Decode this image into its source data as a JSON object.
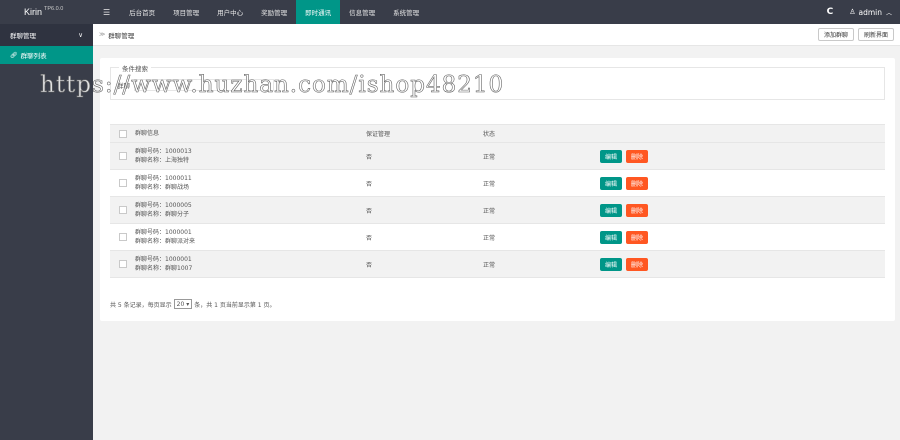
{
  "app": {
    "logo": "Kirin",
    "logo_sup": "TP6.0.0"
  },
  "nav": {
    "menu_icon": "☰",
    "items": [
      {
        "label": "后台首页"
      },
      {
        "label": "项目管理"
      },
      {
        "label": "用户中心"
      },
      {
        "label": "奖励管理"
      },
      {
        "label": "即时通讯"
      },
      {
        "label": "信息管理"
      },
      {
        "label": "系统管理"
      }
    ],
    "active_index": 4,
    "refresh_icon": "refresh-icon",
    "user": "admin"
  },
  "sidebar": {
    "group": "群聊管理",
    "item": "群聊列表"
  },
  "breadcrumb": {
    "text": "群聊管理",
    "btn_add": "添加群聊",
    "btn_refresh": "刷新界面"
  },
  "search": {
    "legend": "条件搜索",
    "label": "群聊",
    "placeholder": ""
  },
  "table": {
    "headers": {
      "info": "群聊信息",
      "owner": "保证管理",
      "status": "状态"
    },
    "rows": [
      {
        "line1": "群聊号码：1000013",
        "line2": "群聊名称：上海独特",
        "owner": "否",
        "status": "正常"
      },
      {
        "line1": "群聊号码：1000011",
        "line2": "群聊名称：群聊战场",
        "owner": "否",
        "status": "正常"
      },
      {
        "line1": "群聊号码：1000005",
        "line2": "群聊名称：群聊分子",
        "owner": "否",
        "status": "正常"
      },
      {
        "line1": "群聊号码：1000001",
        "line2": "群聊名称：群聊派对来",
        "owner": "否",
        "status": "正常"
      },
      {
        "line1": "群聊号码：1000001",
        "line2": "群聊名称：群聊1007",
        "owner": "否",
        "status": "正常"
      }
    ],
    "edit_label": "编辑",
    "delete_label": "删除"
  },
  "pager": {
    "prefix": "共 5 条记录，每页显示",
    "page_size": "20",
    "suffix": "条，共 1 页当前显示第 1 页。"
  },
  "watermark": "https://www.huzhan.com/ishop48210",
  "colors": {
    "accent": "#009688",
    "danger": "#ff5722",
    "dark": "#393d49"
  }
}
